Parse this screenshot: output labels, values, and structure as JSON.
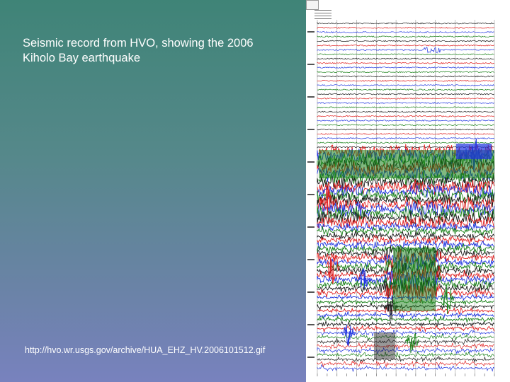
{
  "slide": {
    "title": "Seismic record from HVO, showing the 2006 Kiholo Bay earthquake",
    "url": "http://hvo.wr.usgs.gov/archive/HUA_EHZ_HV.2006101512.gif"
  },
  "seismogram": {
    "trace_colors": [
      "#1a1a1a",
      "#e02020",
      "#1f35e0",
      "#178017"
    ],
    "grid_color": "#9a9a9a"
  }
}
